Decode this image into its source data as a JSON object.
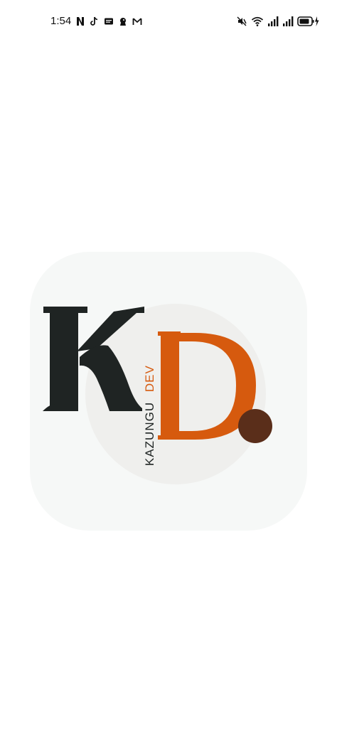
{
  "status_bar": {
    "time": "1:54",
    "notification_icons": [
      "netflix-icon",
      "tiktok-icon",
      "messages-icon",
      "premier-league-icon",
      "gmail-icon"
    ],
    "system_icons": [
      "mute-vibrate-icon",
      "wifi-icon",
      "signal-icon",
      "signal-icon",
      "battery-charging-icon"
    ]
  },
  "logo": {
    "monogram_k": "K",
    "monogram_d": "D",
    "brand_name": "KAZUNGU",
    "brand_suffix": "DEV",
    "colors": {
      "card_background": "#f6f8f7",
      "circle_background": "#efefed",
      "k_color": "#1f2423",
      "d_color": "#d65a0e",
      "dot_color": "#5a2e1a",
      "suffix_color": "#d65a0e"
    }
  }
}
